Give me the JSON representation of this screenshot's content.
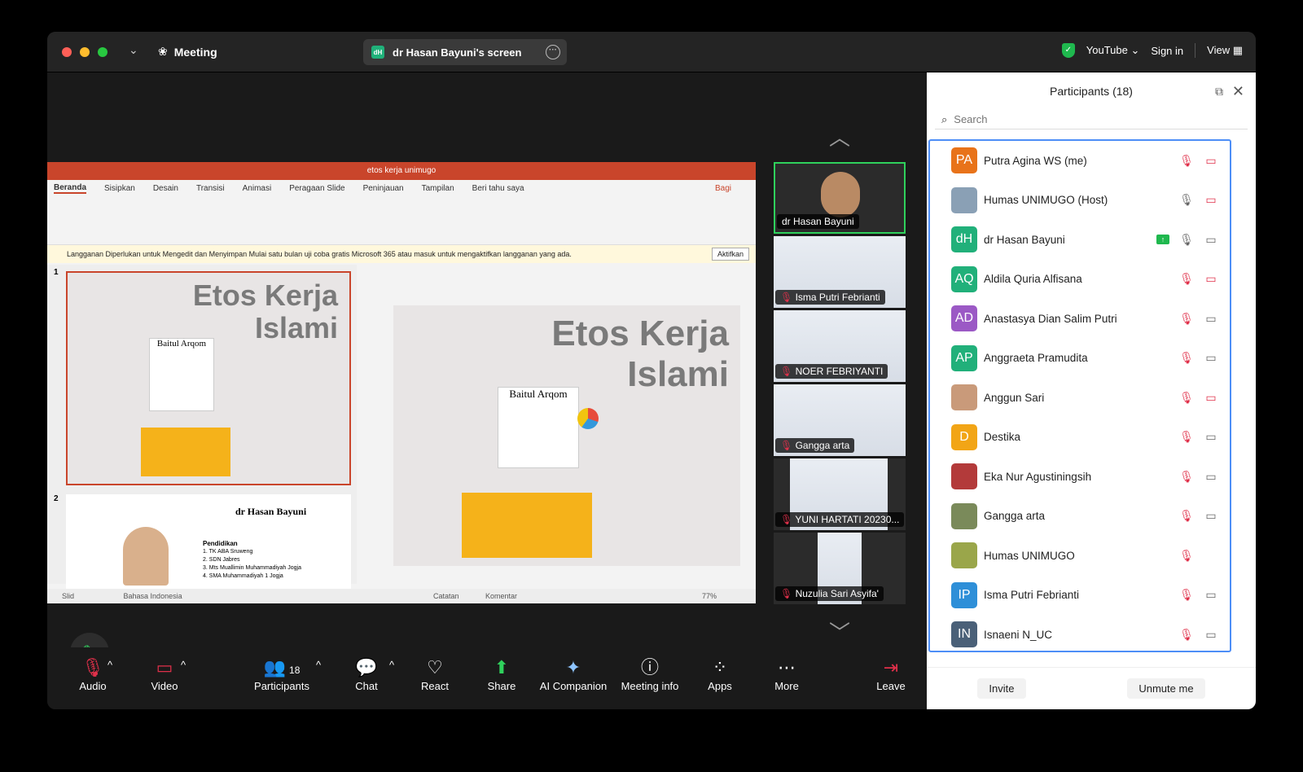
{
  "titlebar": {
    "app_label": "Meeting",
    "screen_share": "dr Hasan Bayuni's screen",
    "screen_badge": "dH",
    "youtube": "YouTube",
    "sign_in": "Sign in",
    "view": "View"
  },
  "ppt": {
    "file_title": "etos kerja unimugo",
    "tabs": [
      "Beranda",
      "Sisipkan",
      "Desain",
      "Transisi",
      "Animasi",
      "Peragaan Slide",
      "Peninjauan",
      "Tampilan",
      "Beri tahu saya"
    ],
    "share": "Bagi",
    "warning": "Langganan Diperlukan untuk Mengedit dan Menyimpan  Mulai satu bulan uji coba gratis Microsoft 365 atau masuk untuk mengaktifkan langganan yang ada.",
    "activate": "Aktifkan",
    "slide1_title_line1": "Etos Kerja",
    "slide1_title_line2": "Islami",
    "slide1_board": "Baitul Arqom",
    "slide2_name": "dr Hasan Bayuni",
    "slide2_section": "Pendidikan",
    "slide2_items": [
      "1.  TK ABA Sruweng",
      "2.  SDN Jabres",
      "3.  Mts Muallimin Muhammadiyah Jogja",
      "4.  SMA Muhammadiyah 1 Jogja"
    ],
    "status_slide": "Slid",
    "status_lang": "Bahasa Indonesia",
    "status_notes": "Catatan",
    "status_comments": "Komentar",
    "zoom": "77%",
    "thumb_nums": [
      "1",
      "2"
    ]
  },
  "gallery": [
    {
      "name": "dr Hasan Bayuni"
    },
    {
      "name": "Isma Putri Febrianti"
    },
    {
      "name": "NOER FEBRIYANTI"
    },
    {
      "name": "Gangga arta"
    },
    {
      "name": "YUNI HARTATI 20230..."
    },
    {
      "name": "Nuzulia Sari Asyifa'"
    }
  ],
  "toolbar": {
    "audio": "Audio",
    "video": "Video",
    "participants": "Participants",
    "participants_count": "18",
    "chat": "Chat",
    "react": "React",
    "share": "Share",
    "ai": "AI Companion",
    "info": "Meeting info",
    "apps": "Apps",
    "more": "More",
    "leave": "Leave"
  },
  "panel": {
    "title": "Participants (18)",
    "search_placeholder": "Search",
    "invite": "Invite",
    "unmute": "Unmute me",
    "participants": [
      {
        "initials": "PA",
        "name": "Putra Agina WS (me)",
        "color": "#e8731a",
        "mic": "muted",
        "cam": "off"
      },
      {
        "initials": "",
        "name": "Humas UNIMUGO (Host)",
        "color": "#8aa0b5",
        "mic": "on",
        "cam": "off"
      },
      {
        "initials": "dH",
        "name": "dr Hasan Bayuni",
        "color": "#21b07a",
        "mic": "on",
        "cam": "on",
        "sharing": true
      },
      {
        "initials": "AQ",
        "name": "Aldila Quria Alfisana",
        "color": "#21b07a",
        "mic": "muted",
        "cam": "off"
      },
      {
        "initials": "AD",
        "name": "Anastasya Dian Salim Putri",
        "color": "#9b59c5",
        "mic": "muted",
        "cam": "on"
      },
      {
        "initials": "AP",
        "name": "Anggraeta Pramudita",
        "color": "#21b07a",
        "mic": "muted",
        "cam": "on"
      },
      {
        "initials": "",
        "name": "Anggun Sari",
        "color": "#c99a7a",
        "mic": "muted",
        "cam": "off"
      },
      {
        "initials": "D",
        "name": "Destika",
        "color": "#f2a516",
        "mic": "muted",
        "cam": "on"
      },
      {
        "initials": "",
        "name": "Eka Nur Agustiningsih",
        "color": "#b33a3a",
        "mic": "muted",
        "cam": "on"
      },
      {
        "initials": "",
        "name": "Gangga arta",
        "color": "#7a8a5a",
        "mic": "muted",
        "cam": "on"
      },
      {
        "initials": "",
        "name": "Humas UNIMUGO",
        "color": "#9aa64a",
        "mic": "muted",
        "cam": ""
      },
      {
        "initials": "IP",
        "name": "Isma Putri Febrianti",
        "color": "#2e8fd8",
        "mic": "muted",
        "cam": "on"
      },
      {
        "initials": "IN",
        "name": "Isnaeni N_UC",
        "color": "#4a6078",
        "mic": "muted",
        "cam": "on"
      }
    ]
  }
}
